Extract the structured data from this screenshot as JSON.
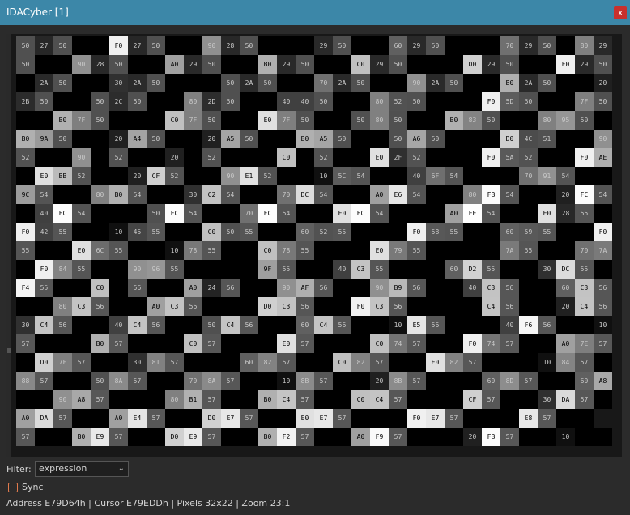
{
  "window": {
    "title": "IDACyber [1]",
    "close_label": "x"
  },
  "filter": {
    "label": "Filter:",
    "value": "expression"
  },
  "sync": {
    "label": "Sync",
    "checked": false
  },
  "status": {
    "address": "Address E79D64h",
    "cursor": "Cursor E79EDDh",
    "pixels": "Pixels 32x22",
    "zoom": "Zoom 23:1",
    "line": "Address E79D64h | Cursor E79EDDh | Pixels 32x22  | Zoom 23:1"
  },
  "grid": {
    "columns": 32,
    "rows": 22,
    "data": [
      [
        "50",
        "27",
        "50",
        "00",
        "00",
        "F0",
        "27",
        "50",
        "00",
        "00",
        "90",
        "28",
        "50",
        "00",
        "00",
        "00",
        "29",
        "50",
        "00",
        "00",
        "60",
        "29",
        "50",
        "00",
        "00",
        "00",
        "70",
        "29",
        "50",
        "00",
        "80",
        "29"
      ],
      [
        "50",
        "00",
        "00",
        "90",
        "28",
        "50",
        "00",
        "00",
        "A0",
        "29",
        "50",
        "00",
        "00",
        "B0",
        "29",
        "50",
        "00",
        "00",
        "C0",
        "29",
        "50",
        "00",
        "00",
        "00",
        "D0",
        "29",
        "50",
        "00",
        "00",
        "F0",
        "29",
        "50"
      ],
      [
        "00",
        "2A",
        "50",
        "00",
        "00",
        "30",
        "2A",
        "50",
        "00",
        "00",
        "00",
        "50",
        "2A",
        "50",
        "00",
        "00",
        "70",
        "2A",
        "50",
        "00",
        "00",
        "90",
        "2A",
        "50",
        "00",
        "00",
        "B0",
        "2A",
        "50",
        "00",
        "00",
        "20"
      ],
      [
        "2B",
        "50",
        "00",
        "00",
        "50",
        "2C",
        "50",
        "00",
        "00",
        "80",
        "2D",
        "50",
        "00",
        "00",
        "40",
        "40",
        "50",
        "00",
        "00",
        "80",
        "52",
        "50",
        "00",
        "00",
        "00",
        "F0",
        "5D",
        "50",
        "00",
        "00",
        "7F",
        "50"
      ],
      [
        "00",
        "00",
        "B0",
        "7F",
        "50",
        "00",
        "00",
        "00",
        "C0",
        "7F",
        "50",
        "00",
        "00",
        "E0",
        "7F",
        "50",
        "00",
        "00",
        "50",
        "80",
        "50",
        "00",
        "00",
        "B0",
        "83",
        "50",
        "00",
        "00",
        "80",
        "95",
        "50",
        "00"
      ],
      [
        "B0",
        "9A",
        "50",
        "00",
        "00",
        "20",
        "A4",
        "50",
        "00",
        "00",
        "20",
        "A5",
        "50",
        "00",
        "00",
        "B0",
        "A5",
        "50",
        "00",
        "00",
        "50",
        "A6",
        "50",
        "00",
        "00",
        "00",
        "D0",
        "4C",
        "51",
        "00",
        "00",
        "90"
      ],
      [
        "52",
        "00",
        "00",
        "90",
        "00",
        "52",
        "00",
        "00",
        "20",
        "00",
        "52",
        "00",
        "00",
        "00",
        "C0",
        "00",
        "52",
        "00",
        "00",
        "E0",
        "2F",
        "52",
        "00",
        "00",
        "00",
        "F0",
        "5A",
        "52",
        "00",
        "00",
        "F0",
        "AE"
      ],
      [
        "00",
        "E0",
        "BB",
        "52",
        "00",
        "00",
        "20",
        "CF",
        "52",
        "00",
        "00",
        "90",
        "E1",
        "52",
        "00",
        "00",
        "10",
        "5C",
        "54",
        "00",
        "00",
        "40",
        "6F",
        "54",
        "00",
        "00",
        "00",
        "70",
        "91",
        "54",
        "00",
        "00"
      ],
      [
        "9C",
        "54",
        "00",
        "00",
        "80",
        "B0",
        "54",
        "00",
        "00",
        "30",
        "C2",
        "54",
        "00",
        "00",
        "70",
        "DC",
        "54",
        "00",
        "00",
        "A0",
        "E6",
        "54",
        "00",
        "00",
        "80",
        "FB",
        "54",
        "00",
        "00",
        "20",
        "FC",
        "54"
      ],
      [
        "00",
        "40",
        "FC",
        "54",
        "00",
        "00",
        "00",
        "50",
        "FC",
        "54",
        "00",
        "00",
        "70",
        "FC",
        "54",
        "00",
        "00",
        "E0",
        "FC",
        "54",
        "00",
        "00",
        "00",
        "A0",
        "FE",
        "54",
        "00",
        "00",
        "E0",
        "28",
        "55",
        "00"
      ],
      [
        "F0",
        "42",
        "55",
        "00",
        "00",
        "10",
        "45",
        "55",
        "00",
        "00",
        "C0",
        "50",
        "55",
        "00",
        "00",
        "60",
        "52",
        "55",
        "00",
        "00",
        "00",
        "F0",
        "58",
        "55",
        "00",
        "00",
        "60",
        "59",
        "55",
        "00",
        "00",
        "F0"
      ],
      [
        "55",
        "00",
        "00",
        "E0",
        "6C",
        "55",
        "00",
        "00",
        "10",
        "78",
        "55",
        "00",
        "00",
        "C0",
        "78",
        "55",
        "00",
        "00",
        "00",
        "E0",
        "79",
        "55",
        "00",
        "00",
        "00",
        "00",
        "7A",
        "55",
        "00",
        "00",
        "70",
        "7A"
      ],
      [
        "00",
        "F0",
        "84",
        "55",
        "00",
        "00",
        "90",
        "96",
        "55",
        "00",
        "00",
        "00",
        "00",
        "9F",
        "55",
        "00",
        "00",
        "40",
        "C3",
        "55",
        "00",
        "00",
        "00",
        "60",
        "D2",
        "55",
        "00",
        "00",
        "30",
        "DC",
        "55",
        "00"
      ],
      [
        "F4",
        "55",
        "00",
        "00",
        "C0",
        "00",
        "56",
        "00",
        "00",
        "A0",
        "24",
        "56",
        "00",
        "00",
        "90",
        "AF",
        "56",
        "00",
        "00",
        "90",
        "B9",
        "56",
        "00",
        "00",
        "40",
        "C3",
        "56",
        "00",
        "00",
        "60",
        "C3",
        "56"
      ],
      [
        "00",
        "00",
        "80",
        "C3",
        "56",
        "00",
        "00",
        "A0",
        "C3",
        "56",
        "00",
        "00",
        "00",
        "D0",
        "C3",
        "56",
        "00",
        "00",
        "F0",
        "C3",
        "56",
        "00",
        "00",
        "00",
        "00",
        "C4",
        "56",
        "00",
        "00",
        "20",
        "C4",
        "56"
      ],
      [
        "30",
        "C4",
        "56",
        "00",
        "00",
        "40",
        "C4",
        "56",
        "00",
        "00",
        "50",
        "C4",
        "56",
        "00",
        "00",
        "60",
        "C4",
        "56",
        "00",
        "00",
        "10",
        "E5",
        "56",
        "00",
        "00",
        "00",
        "40",
        "F6",
        "56",
        "00",
        "00",
        "10"
      ],
      [
        "57",
        "00",
        "00",
        "00",
        "B0",
        "57",
        "00",
        "00",
        "00",
        "C0",
        "57",
        "00",
        "00",
        "00",
        "E0",
        "57",
        "00",
        "00",
        "00",
        "C0",
        "74",
        "57",
        "00",
        "00",
        "F0",
        "74",
        "57",
        "00",
        "00",
        "A0",
        "7E",
        "57"
      ],
      [
        "00",
        "D0",
        "7F",
        "57",
        "00",
        "00",
        "30",
        "81",
        "57",
        "00",
        "00",
        "00",
        "60",
        "82",
        "57",
        "00",
        "00",
        "C0",
        "82",
        "57",
        "00",
        "00",
        "E0",
        "82",
        "57",
        "00",
        "00",
        "00",
        "10",
        "84",
        "57",
        "00"
      ],
      [
        "88",
        "57",
        "00",
        "00",
        "50",
        "8A",
        "57",
        "00",
        "00",
        "70",
        "8A",
        "57",
        "00",
        "00",
        "10",
        "8B",
        "57",
        "00",
        "00",
        "20",
        "8B",
        "57",
        "00",
        "00",
        "00",
        "60",
        "8D",
        "57",
        "00",
        "00",
        "60",
        "A8"
      ],
      [
        "00",
        "00",
        "90",
        "A8",
        "57",
        "00",
        "00",
        "00",
        "80",
        "B1",
        "57",
        "00",
        "00",
        "B0",
        "C4",
        "57",
        "00",
        "00",
        "C0",
        "C4",
        "57",
        "00",
        "00",
        "00",
        "CF",
        "57",
        "00",
        "00",
        "30",
        "DA",
        "57",
        "00"
      ],
      [
        "A0",
        "DA",
        "57",
        "00",
        "00",
        "A0",
        "E4",
        "57",
        "00",
        "00",
        "D0",
        "E7",
        "57",
        "00",
        "00",
        "E0",
        "E7",
        "57",
        "00",
        "00",
        "00",
        "F0",
        "E7",
        "57",
        "00",
        "00",
        "00",
        "E8",
        "57",
        "00",
        "00"
      ],
      [
        "57",
        "00",
        "00",
        "B0",
        "E9",
        "57",
        "00",
        "00",
        "D0",
        "E9",
        "57",
        "00",
        "00",
        "B0",
        "F2",
        "57",
        "00",
        "00",
        "A0",
        "F9",
        "57",
        "00",
        "00",
        "00",
        "20",
        "FB",
        "57",
        "00",
        "00",
        "10",
        "00",
        "00"
      ]
    ]
  }
}
